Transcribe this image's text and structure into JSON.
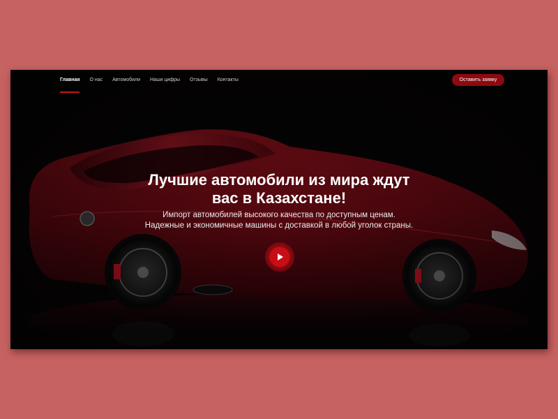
{
  "nav": {
    "items": [
      {
        "label": "Главная",
        "active": true
      },
      {
        "label": "О нас",
        "active": false
      },
      {
        "label": "Автомобили",
        "active": false
      },
      {
        "label": "Наши цифры",
        "active": false
      },
      {
        "label": "Отзывы",
        "active": false
      },
      {
        "label": "Контакты",
        "active": false
      }
    ],
    "cta_label": "Оставить заявку"
  },
  "hero": {
    "title_line1": "Лучшие автомобили из мира ждут",
    "title_line2": "вас в Казахстане!",
    "subtitle_line1": "Импорт автомобилей высокого качества по доступным ценам.",
    "subtitle_line2": "Надежные и экономичные машины с доставкой в любой уголок страны.",
    "play_icon": "play-icon"
  },
  "colors": {
    "page_background": "#c66262",
    "accent": "#8d0a10",
    "play_button": "#c80e14",
    "hero_background": "#050304",
    "car_body": "#6e0b14"
  }
}
